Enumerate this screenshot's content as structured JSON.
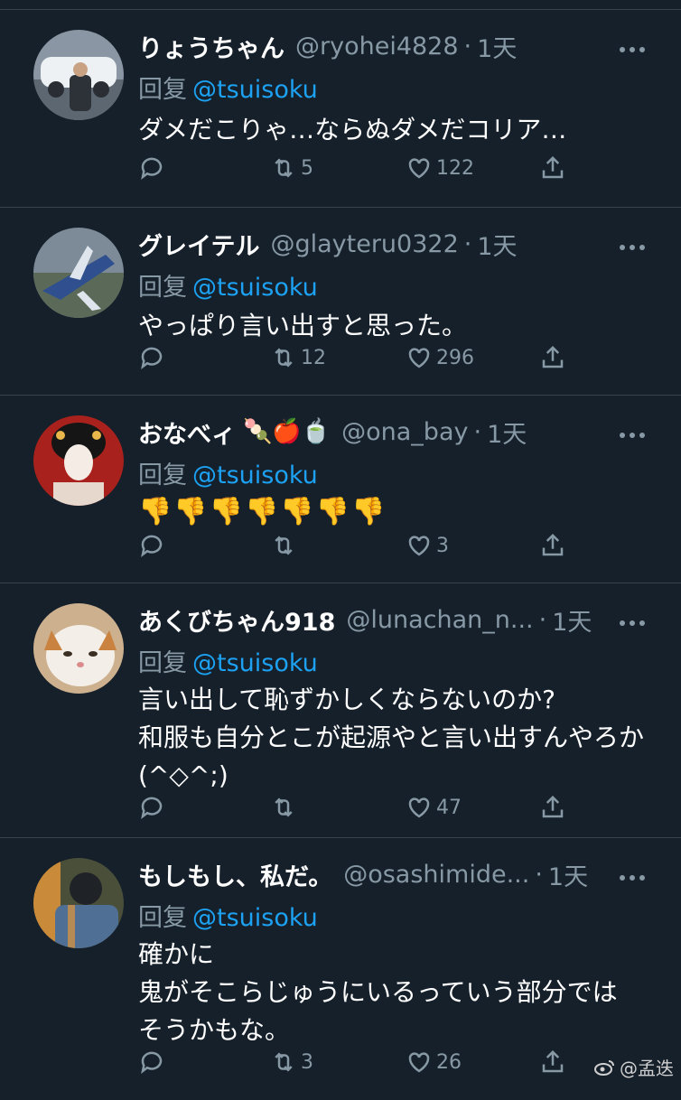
{
  "reply_prefix": "回复",
  "tweets": [
    {
      "name": "りょうちゃん",
      "emoji": "",
      "handle": "@ryohei4828",
      "time": "1天",
      "reply_to": "@tsuisoku",
      "text": "ダメだこりゃ…ならぬダメだコリア…",
      "replies": "",
      "retweets": "5",
      "likes": "122",
      "avatar_colors": [
        "#b8c2cc",
        "#e6e9ec",
        "#3b4048"
      ]
    },
    {
      "name": "グレイテル",
      "emoji": "",
      "handle": "@glayteru0322",
      "time": "1天",
      "reply_to": "@tsuisoku",
      "text": "やっぱり言い出すと思った。",
      "replies": "",
      "retweets": "12",
      "likes": "296",
      "avatar_colors": [
        "#6f7e8c",
        "#aab4be",
        "#2b3a55"
      ]
    },
    {
      "name": "おなべィ",
      "emoji": "🍡🍎🍵",
      "handle": "@ona_bay",
      "time": "1天",
      "reply_to": "@tsuisoku",
      "text": "👎👎👎👎👎👎👎",
      "replies": "",
      "retweets": "",
      "likes": "3",
      "avatar_colors": [
        "#b0231f",
        "#f2e4da",
        "#1c1c1c"
      ]
    },
    {
      "name": "あくびちゃん918",
      "emoji": "",
      "handle": "@lunachan_n...",
      "time": "1天",
      "reply_to": "@tsuisoku",
      "text": "言い出して恥ずかしくならないのか?\n和服も自分とこが起源やと言い出すんやろか (^◇^;)",
      "replies": "",
      "retweets": "",
      "likes": "47",
      "avatar_colors": [
        "#d9c3a5",
        "#f4efe6",
        "#8c6a4a"
      ]
    },
    {
      "name": "もしもし、私だ。",
      "emoji": "",
      "handle": "@osashimide...",
      "time": "1天",
      "reply_to": "@tsuisoku",
      "text": "確かに\n鬼がそこらじゅうにいるっていう部分では\nそうかもな。",
      "replies": "",
      "retweets": "3",
      "likes": "26",
      "avatar_colors": [
        "#3d5a7a",
        "#9bb0c4",
        "#c98a3a"
      ]
    }
  ],
  "watermark": "@孟迭"
}
